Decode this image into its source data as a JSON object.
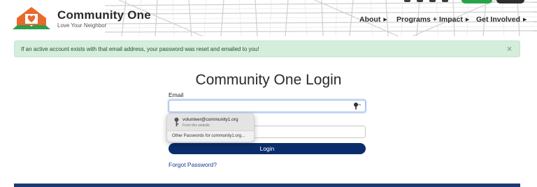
{
  "brand": {
    "title": "Community One",
    "tagline": "Love Your Neighbor"
  },
  "nav": {
    "items": [
      {
        "label": "About"
      },
      {
        "label": "Programs + Impact"
      },
      {
        "label": "Get Involved"
      }
    ]
  },
  "alert": {
    "message": "If an active account exists with that email address, your password was reset and emailed to you!",
    "close_icon": "×"
  },
  "login": {
    "title": "Community One Login",
    "email_label": "Email",
    "email_value": "",
    "password_value": "",
    "submit_label": "Login",
    "forgot_label": "Forgot Password?"
  },
  "autofill": {
    "suggestion_user": "volunteer@community1.org",
    "suggestion_source": "From this website",
    "other_label": "Other Passwords for community1.org…"
  },
  "colors": {
    "brand_orange": "#e8692b",
    "brand_green": "#2f9e4a",
    "primary_navy": "#0b2d6b",
    "alert_bg": "#d5eddb",
    "alert_text": "#1f5132",
    "link_blue": "#13398a"
  },
  "icons": {
    "logo": "house-heart-logo-icon",
    "close": "close-icon",
    "key": "key-icon",
    "caret": "caret-right-icon"
  }
}
